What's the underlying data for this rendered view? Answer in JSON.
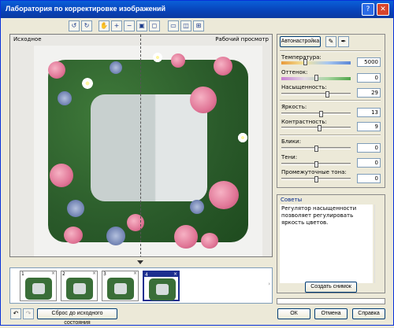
{
  "window": {
    "title": "Лаборатория по корректировке изображений"
  },
  "titlebar_controls": {
    "help": "?",
    "close": "✕"
  },
  "toolbar": {
    "icons": [
      "rotate-left-icon",
      "rotate-right-icon",
      "hand-icon",
      "zoom-in-icon",
      "zoom-out-icon",
      "zoom-fit-icon",
      "zoom-actual-icon",
      "single-view-icon",
      "split-view-icon",
      "quad-view-icon"
    ]
  },
  "preview": {
    "left_label": "Исходное",
    "right_label": "Рабочий просмотр"
  },
  "thumbnails": [
    {
      "number": "1",
      "close": "×"
    },
    {
      "number": "2",
      "close": "×"
    },
    {
      "number": "3",
      "close": "×"
    },
    {
      "number": "4",
      "close": "×"
    }
  ],
  "bottom": {
    "reset_label": "Сброс до исходного состояния",
    "ok_label": "ОК",
    "cancel_label": "Отмена",
    "help_label": "Справка"
  },
  "adjust": {
    "auto_label": "Автонастройка",
    "sliders": [
      {
        "label": "Температура:",
        "value": "5000"
      },
      {
        "label": "Оттенок:",
        "value": "0"
      },
      {
        "label": "Насыщенность:",
        "value": "29"
      },
      {
        "label": "Яркость:",
        "value": "13"
      },
      {
        "label": "Контрастность:",
        "value": "9"
      },
      {
        "label": "Блики:",
        "value": "0"
      },
      {
        "label": "Тени:",
        "value": "0"
      },
      {
        "label": "Промежуточные тона:",
        "value": "0"
      }
    ]
  },
  "tips": {
    "header": "Советы",
    "text": "Регулятор насыщенности позволяет регулировать яркость цветов.",
    "snapshot_label": "Создать снимок"
  },
  "colors": {
    "title_bar": "#0842b8",
    "window_bg": "#ece9d8",
    "tips_header": "#00268a"
  }
}
